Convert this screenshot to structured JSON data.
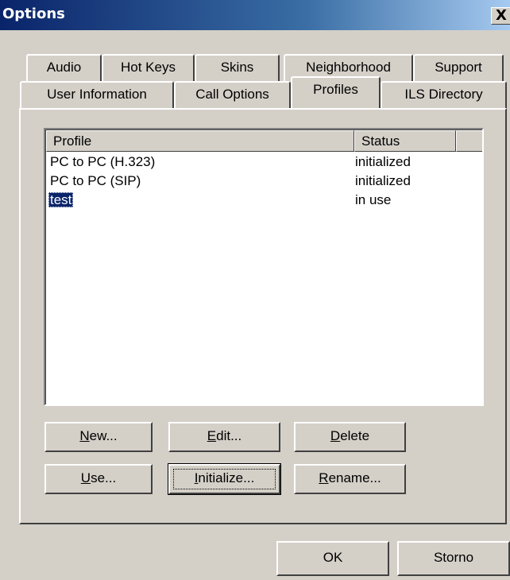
{
  "window": {
    "title": "Options",
    "close_glyph": "X"
  },
  "tabs": {
    "row1": [
      {
        "label": "Audio"
      },
      {
        "label": "Hot Keys"
      },
      {
        "label": "Skins"
      },
      {
        "label": "Neighborhood"
      },
      {
        "label": "Support"
      }
    ],
    "row2": [
      {
        "label": "User Information"
      },
      {
        "label": "Call Options"
      },
      {
        "label": "Profiles",
        "selected": true
      },
      {
        "label": "ILS Directory"
      }
    ]
  },
  "profiles_list": {
    "columns": [
      "Profile",
      "Status"
    ],
    "rows": [
      {
        "profile": "PC to PC (H.323)",
        "status": "initialized"
      },
      {
        "profile": "PC to PC (SIP)",
        "status": "initialized"
      },
      {
        "profile": "test",
        "status": "in use",
        "selected": true
      }
    ]
  },
  "buttons": {
    "new": {
      "mnemonic": "N",
      "rest": "ew..."
    },
    "edit": {
      "mnemonic": "E",
      "rest": "dit..."
    },
    "delete": {
      "mnemonic": "D",
      "rest": "elete"
    },
    "use": {
      "mnemonic": "U",
      "rest": "se..."
    },
    "initialize": {
      "mnemonic": "I",
      "rest": "nitialize..."
    },
    "rename": {
      "mnemonic": "R",
      "rest": "ename..."
    }
  },
  "dialog_buttons": {
    "ok": "OK",
    "cancel": "Storno"
  },
  "colors": {
    "face": "#d4d0c8",
    "title_active": "#0a246a",
    "selection": "#0a246a"
  }
}
